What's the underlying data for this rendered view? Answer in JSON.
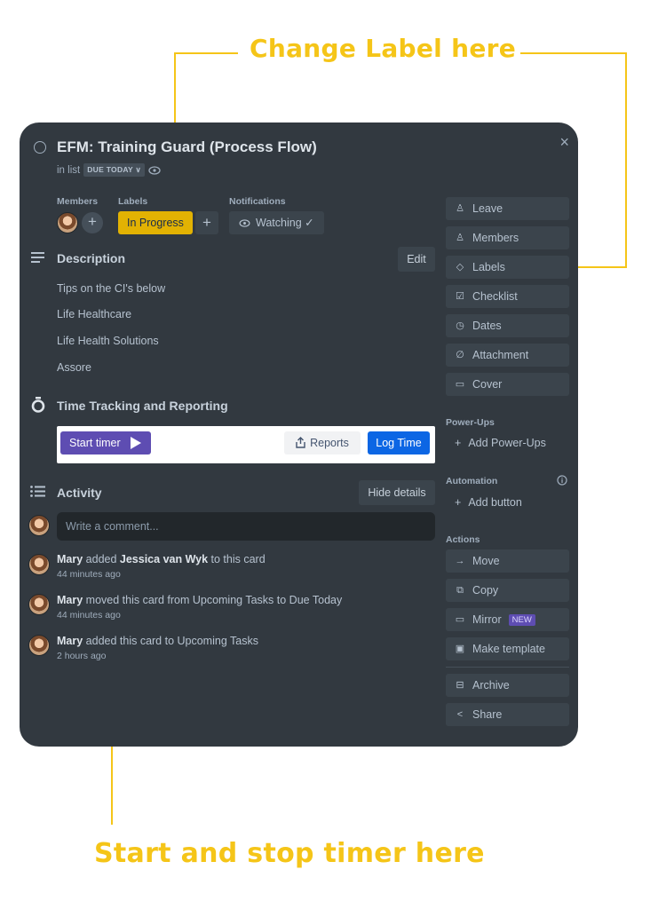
{
  "callouts": {
    "top": "Change Label here",
    "bottom": "Start and stop timer here"
  },
  "colors": {
    "accent_yellow": "#f5c518",
    "card_bg": "#323940",
    "label_yellow": "#e2b203",
    "timer_purple": "#5e4db2",
    "log_blue": "#0c66e4"
  },
  "card": {
    "title": "EFM: Training Guard (Process Flow)",
    "in_list_prefix": "in list",
    "list_name": "DUE TODAY ∨",
    "close_icon": "×",
    "members_label": "Members",
    "labels_label": "Labels",
    "notifications_label": "Notifications",
    "label_value": "In Progress",
    "add_symbol": "+",
    "watching_label": "Watching ✓",
    "description": {
      "title": "Description",
      "edit_label": "Edit",
      "lines": [
        "Tips on the CI's below",
        "Life Healthcare",
        "Life Health Solutions",
        "Assore"
      ]
    },
    "time_tracking": {
      "title": "Time Tracking and Reporting",
      "start_label": "Start timer",
      "reports_label": "Reports",
      "log_label": "Log Time"
    },
    "activity": {
      "title": "Activity",
      "hide_details": "Hide details",
      "comment_placeholder": "Write a comment...",
      "items": [
        {
          "user": "Mary",
          "pre": " added ",
          "bold": "Jessica van Wyk",
          "post": " to this card",
          "time": "44 minutes ago"
        },
        {
          "user": "Mary",
          "pre": " moved this card from Upcoming Tasks to Due Today",
          "bold": "",
          "post": "",
          "time": "44 minutes ago"
        },
        {
          "user": "Mary",
          "pre": " added this card to Upcoming Tasks",
          "bold": "",
          "post": "",
          "time": "2 hours ago"
        }
      ]
    }
  },
  "sidebar": {
    "buttons": [
      "Leave",
      "Members",
      "Labels",
      "Checklist",
      "Dates",
      "Attachment",
      "Cover"
    ],
    "powerups_head": "Power-Ups",
    "add_powerups": "Add Power-Ups",
    "automation_head": "Automation",
    "add_button": "Add button",
    "actions_head": "Actions",
    "actions": [
      "Move",
      "Copy",
      "Mirror",
      "Make template",
      "Archive",
      "Share"
    ],
    "new_badge": "NEW"
  }
}
